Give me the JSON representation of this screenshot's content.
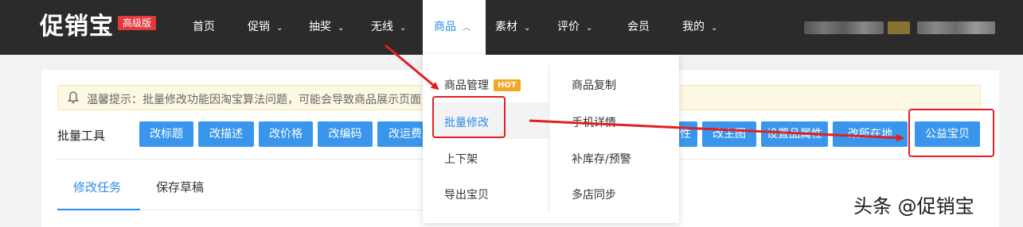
{
  "header": {
    "logo": "促销宝",
    "badge": "高级版",
    "nav": [
      {
        "label": "首页",
        "chevron": false
      },
      {
        "label": "促销",
        "chevron": true
      },
      {
        "label": "抽奖",
        "chevron": true
      },
      {
        "label": "无线",
        "chevron": true
      },
      {
        "label": "商品",
        "chevron": true,
        "active": true
      },
      {
        "label": "素材",
        "chevron": true
      },
      {
        "label": "评价",
        "chevron": true
      },
      {
        "label": "会员",
        "chevron": false
      },
      {
        "label": "我的",
        "chevron": true
      }
    ],
    "chevron_down": "⌄",
    "chevron_up": "︿"
  },
  "notice": {
    "icon": "bell-icon",
    "text": "温馨提示：批量修改功能因淘宝算法问题，可能会导致商品展示页面"
  },
  "tools": {
    "label": "批量工具",
    "buttons": [
      "改标题",
      "改描述",
      "改价格",
      "改编码",
      "改运费",
      "性",
      "改主图",
      "设置品属性",
      "改所在地",
      "公益宝贝"
    ]
  },
  "tabs": [
    "修改任务",
    "保存草稿"
  ],
  "dropdown": {
    "left": [
      {
        "label": "商品管理",
        "hot": "HOT"
      },
      {
        "label": "批量修改"
      },
      {
        "label": "上下架"
      },
      {
        "label": "导出宝贝"
      }
    ],
    "right": [
      "商品复制",
      "手机详情",
      "补库存/预警",
      "多店同步"
    ]
  },
  "watermark": "头条 @促销宝",
  "colors": {
    "accent": "#2a8de9",
    "button": "#3a96ec",
    "topbar": "#2b2b2b",
    "annotation": "#e02020"
  }
}
